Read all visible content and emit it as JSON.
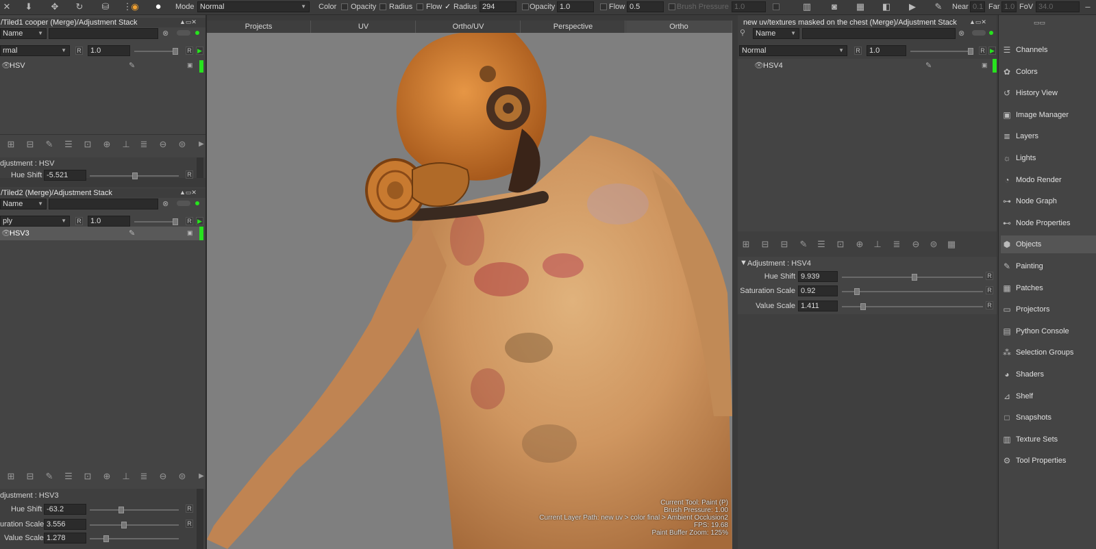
{
  "toolbar": {
    "mode_label": "Mode",
    "mode_value": "Normal",
    "color_label": "Color",
    "opacity_label": "Opacity",
    "radius_label": "Radius",
    "flow_label": "Flow",
    "radius_checked_label": "Radius",
    "radius_value": "294",
    "opacity2_label": "Opacity",
    "opacity2_value": "1.0",
    "flow2_label": "Flow",
    "flow2_value": "0.5",
    "brush_pressure_label": "Brush Pressure",
    "brush_pressure_value": "1.0",
    "near_label": "Near",
    "near_value": "0.1",
    "far_label": "Far",
    "far_value": "1.0",
    "fov_label": "FoV",
    "fov_value": "34.0"
  },
  "left_top_panel": {
    "title": "/Tiled1 cooper (Merge)/Adjustment Stack",
    "filter_by": "Name",
    "blend_mode": "rmal",
    "opacity_value": "1.0",
    "r_label": "R",
    "layers": [
      {
        "name": "HSV"
      }
    ],
    "adjustment_title": "djustment : HSV",
    "hue_shift_label": "Hue Shift",
    "hue_shift_value": "-5.521"
  },
  "left_mid_panel": {
    "title": "/Tiled2 (Merge)/Adjustment Stack",
    "filter_by": "Name",
    "blend_mode": "ply",
    "opacity_value": "1.0",
    "layers": [
      {
        "name": "HSV3"
      }
    ],
    "adjustment_title": "djustment : HSV3",
    "hue_shift_label": "Hue Shift",
    "hue_shift_value": "-63.2",
    "sat_scale_label": "uration Scale",
    "sat_scale_value": "3.556",
    "val_scale_label": "Value Scale",
    "val_scale_value": "1.278"
  },
  "viewport_tabs": [
    "Projects",
    "UV",
    "Ortho/UV",
    "Perspective",
    "Ortho"
  ],
  "viewport_status": {
    "current_tool": "Current Tool: Paint (P)",
    "brush_pressure": "Brush Pressure: 1.00",
    "layer_path": "Current Layer Path: new uv > color final > Ambient Occlusion2",
    "fps": "FPS: 19.68",
    "paint_buffer": "Paint Buffer Zoom: 125%"
  },
  "right_panel": {
    "title": "new uv/textures  masked on the  chest  (Merge)/Adjustment Stack",
    "filter_by": "Name",
    "blend_mode": "Normal",
    "opacity_value": "1.0",
    "layers": [
      {
        "name": "HSV4"
      }
    ],
    "adjustment_title": "Adjustment : HSV4",
    "hue_shift_label": "Hue Shift",
    "hue_shift_value": "9.939",
    "hue_shift_level": 0.52,
    "sat_scale_label": "Saturation Scale",
    "sat_scale_value": "0.92",
    "sat_scale_level": 0.09,
    "val_scale_label": "Value Scale",
    "val_scale_value": "1.411",
    "val_scale_level": 0.14
  },
  "sidebar": {
    "items": [
      {
        "label": "Channels",
        "icon": "channels-icon"
      },
      {
        "label": "Colors",
        "icon": "colors-icon"
      },
      {
        "label": "History View",
        "icon": "history-icon"
      },
      {
        "label": "Image Manager",
        "icon": "image-icon"
      },
      {
        "label": "Layers",
        "icon": "layers-icon"
      },
      {
        "label": "Lights",
        "icon": "light-icon"
      },
      {
        "label": "Modo Render",
        "icon": "render-icon"
      },
      {
        "label": "Node Graph",
        "icon": "node-graph-icon"
      },
      {
        "label": "Node Properties",
        "icon": "node-properties-icon"
      },
      {
        "label": "Objects",
        "icon": "objects-icon"
      },
      {
        "label": "Painting",
        "icon": "painting-icon"
      },
      {
        "label": "Patches",
        "icon": "patches-icon"
      },
      {
        "label": "Projectors",
        "icon": "projector-icon"
      },
      {
        "label": "Python Console",
        "icon": "python-icon"
      },
      {
        "label": "Selection Groups",
        "icon": "selection-icon"
      },
      {
        "label": "Shaders",
        "icon": "shader-icon"
      },
      {
        "label": "Shelf",
        "icon": "shelf-icon"
      },
      {
        "label": "Snapshots",
        "icon": "snapshot-icon"
      },
      {
        "label": "Texture Sets",
        "icon": "texture-icon"
      },
      {
        "label": "Tool Properties",
        "icon": "tool-icon"
      }
    ]
  },
  "colors": {
    "active_green": "#27e31e",
    "viewport_bg": "#7f7f7f",
    "skin": "#c98a4f"
  }
}
